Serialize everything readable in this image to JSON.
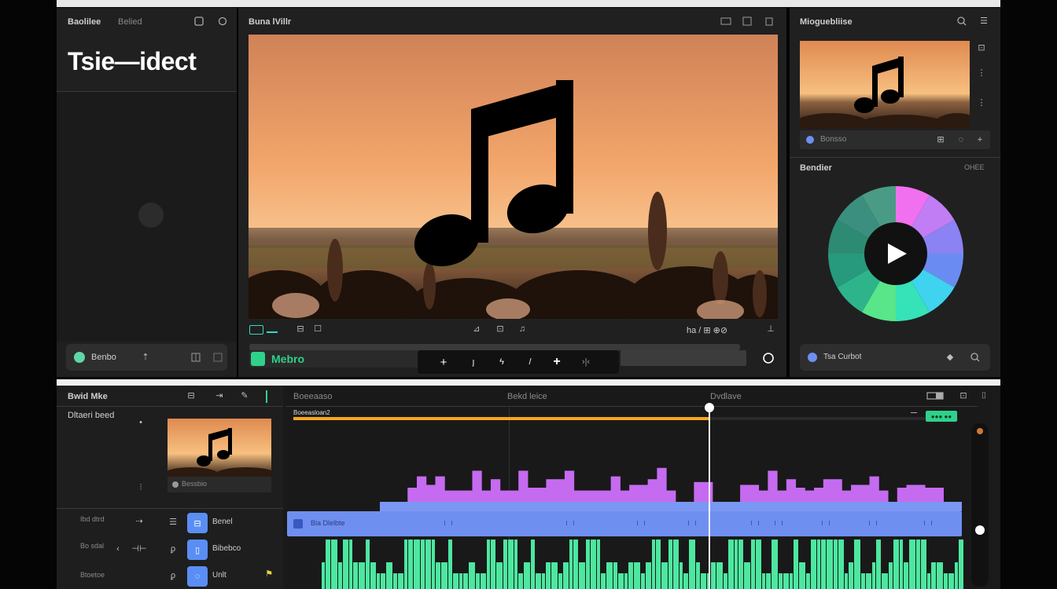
{
  "colors": {
    "accent_green": "#2fd18a",
    "progress_orange": "#f5a623",
    "wave_purple": "#c56bf0",
    "lane_blue": "#6f8ff0",
    "wave_green": "#4de7a0",
    "panel_bg": "#202020"
  },
  "left_panel": {
    "header_title": "Baolilee",
    "header_tab": "Belied",
    "big_title": "Tsie—idect",
    "bottom_button_label": "Benbo",
    "icons": [
      "window-icon",
      "refresh-icon",
      "upload-icon",
      "grid-icon",
      "expand-icon"
    ]
  },
  "preview": {
    "title": "Buna lVillr",
    "icons": [
      "fullscreen-icon",
      "copy-icon",
      "trash-icon"
    ],
    "controls_left": [
      "waveform-icon",
      "waveform-icon",
      "cloud-icon"
    ],
    "controls_mid": [
      "fx-icon",
      "crop-icon",
      "music-icon"
    ],
    "controls_right_text": "ha / ⊞ ⊕⊘",
    "media_label": "Mebro",
    "transport_icons": [
      "plus-icon",
      "cut-icon",
      "lightning-icon",
      "pen-icon",
      "plus-icon",
      "split-icon"
    ]
  },
  "right_panel": {
    "header_title": "Mioguebliise",
    "thumb_caption": "Bonsso",
    "sub_title": "Bendier",
    "sub_tag": "ОНЕЕ",
    "bottom_label": "Tsa Curbot",
    "wheel_colors": [
      "#f170ef",
      "#c07df4",
      "#8b82f3",
      "#6a8cf2",
      "#3fd3ef",
      "#36e2b8",
      "#59e58a",
      "#2eb48b",
      "#279a7d",
      "#2e8b73",
      "#3b8f7f",
      "#4a9b86"
    ]
  },
  "timeline": {
    "panel_title": "Bwid Mke",
    "subtitle": "Dltaeri beed",
    "col1": "Boeeaaso",
    "col2": "Bekd leice",
    "col3": "Dvdlave",
    "clip_label": "Bessbio",
    "track_orange_label": "Boeeasloan2",
    "chip_label": "●●● ●●",
    "lane_text": "Bla Dlelbte",
    "playhead_value": 0.625,
    "progress": 0.625,
    "tracks": [
      {
        "side_label": "Ibd dtrd",
        "name": "Benel"
      },
      {
        "side_label": "Bo sdal",
        "name": "Bibebco"
      },
      {
        "side_label": "Btoetoe",
        "name": "Unlt"
      }
    ],
    "purple_wave": [
      0,
      0,
      0,
      0.25,
      0.45,
      0.3,
      0.45,
      0.2,
      0.2,
      0.2,
      0.55,
      0.2,
      0.4,
      0.2,
      0.2,
      0.55,
      0.25,
      0.25,
      0.4,
      0.4,
      0.55,
      0.2,
      0.2,
      0.2,
      0.2,
      0.45,
      0.2,
      0.3,
      0.3,
      0.4,
      0.6,
      0.2,
      0,
      0,
      0.35,
      0.35,
      0,
      0,
      0,
      0.3,
      0.3,
      0.2,
      0.55,
      0.2,
      0.4,
      0.25,
      0.2,
      0.25,
      0.4,
      0.4,
      0.2,
      0.3,
      0.3,
      0.45,
      0.2,
      0,
      0.25,
      0.3,
      0.3,
      0.25,
      0.25,
      0,
      0
    ]
  }
}
